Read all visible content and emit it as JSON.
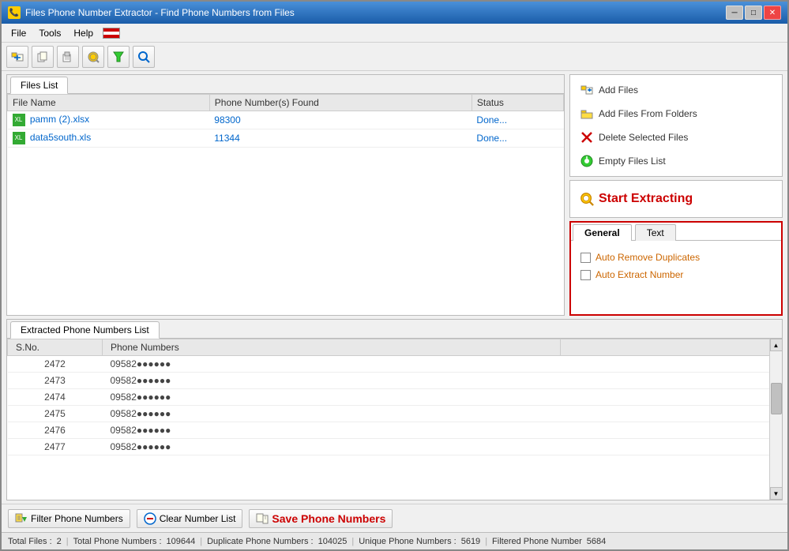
{
  "window": {
    "title": "Files Phone Number Extractor - Find Phone Numbers from Files",
    "icon": "📞"
  },
  "titlebar_buttons": {
    "minimize": "─",
    "maximize": "□",
    "close": "✕"
  },
  "menu": {
    "items": [
      "File",
      "Tools",
      "Help"
    ]
  },
  "toolbar": {
    "buttons": [
      {
        "name": "add-files-toolbar",
        "icon": "📁"
      },
      {
        "name": "copy-toolbar",
        "icon": "📋"
      },
      {
        "name": "paste-toolbar",
        "icon": "📄"
      },
      {
        "name": "filter-toolbar",
        "icon": "🔍"
      },
      {
        "name": "funnel-toolbar",
        "icon": "🔽"
      },
      {
        "name": "search-toolbar",
        "icon": "🔍"
      }
    ]
  },
  "files_panel": {
    "tab_label": "Files List",
    "columns": [
      "File Name",
      "Phone Number(s) Found",
      "Status"
    ],
    "rows": [
      {
        "file": "pamm (2).xlsx",
        "phone_count": "98300",
        "status": "Done..."
      },
      {
        "file": "data5south.xls",
        "phone_count": "11344",
        "status": "Done..."
      }
    ]
  },
  "right_panel": {
    "add_files_label": "Add Files",
    "add_files_folders_label": "Add Files From Folders",
    "delete_files_label": "Delete Selected Files",
    "empty_list_label": "Empty Files List",
    "start_extracting_label": "Start Extracting",
    "settings": {
      "tab_general": "General",
      "tab_text": "Text",
      "auto_remove_duplicates": "Auto Remove Duplicates",
      "auto_extract_number": "Auto Extract Number"
    }
  },
  "phone_list": {
    "tab_label": "Extracted Phone Numbers List",
    "columns": [
      "S.No.",
      "Phone Numbers"
    ],
    "rows": [
      {
        "sno": "2472",
        "phone": "09582●●●●●●"
      },
      {
        "sno": "2473",
        "phone": "09582●●●●●●"
      },
      {
        "sno": "2474",
        "phone": "09582●●●●●●"
      },
      {
        "sno": "2475",
        "phone": "09582●●●●●●"
      },
      {
        "sno": "2476",
        "phone": "09582●●●●●●"
      },
      {
        "sno": "2477",
        "phone": "09582●●●●●●"
      }
    ]
  },
  "bottom_toolbar": {
    "filter_btn": "Filter Phone Numbers",
    "clear_btn": "Clear Number List",
    "save_btn": "Save Phone Numbers"
  },
  "status_bar": {
    "total_files_label": "Total Files :",
    "total_files_val": "2",
    "total_phones_label": "Total Phone Numbers :",
    "total_phones_val": "109644",
    "duplicate_label": "Duplicate Phone Numbers :",
    "duplicate_val": "104025",
    "unique_label": "Unique Phone Numbers :",
    "unique_val": "5619",
    "filtered_label": "Filtered Phone Number",
    "filtered_val": "5684"
  }
}
